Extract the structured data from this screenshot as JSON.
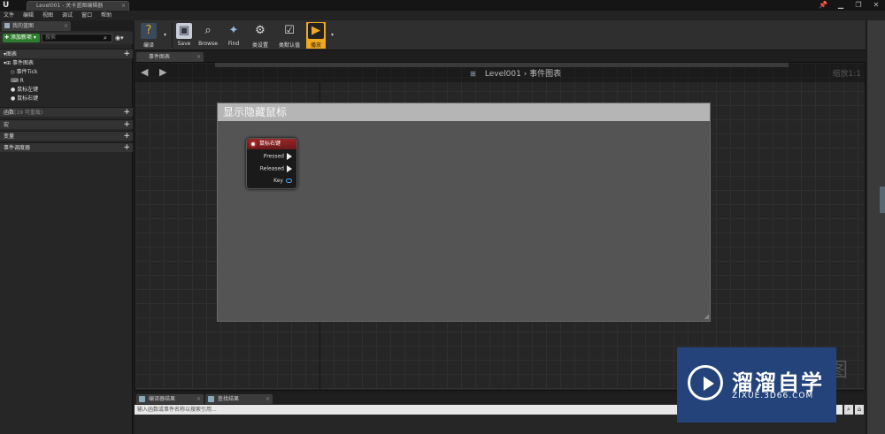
{
  "window": {
    "tab_title": "Level001 - 关卡蓝图编辑器",
    "tab_close": "×",
    "controls": [
      "📌",
      "▁",
      "❐",
      "✕"
    ]
  },
  "menu": [
    "文件",
    "编辑",
    "视图",
    "调试",
    "窗口",
    "帮助"
  ],
  "left_panel": {
    "tab_label": "我的蓝图",
    "add_button": "✚ 添加新项 ▾",
    "search_placeholder": "搜索",
    "sections": {
      "graphs": "▾图表",
      "functions_label": "函数",
      "functions_count": "(19 可重载)",
      "macros": "宏",
      "variables": "变量",
      "dispatchers": "事件调度器"
    },
    "tree": [
      "事件图表",
      "事件Tick",
      "R",
      "鼠标左键",
      "鼠标右键"
    ]
  },
  "toolbar": {
    "buttons": [
      {
        "label": "编译",
        "icon": "compile-icon"
      },
      {
        "label": "Save",
        "icon": "save-icon"
      },
      {
        "label": "Browse",
        "icon": "browse-icon"
      },
      {
        "label": "Find",
        "icon": "find-icon"
      },
      {
        "label": "类设置",
        "icon": "class-settings-icon"
      },
      {
        "label": "类默认值",
        "icon": "class-defaults-icon"
      },
      {
        "label": "播放",
        "icon": "play-icon"
      }
    ]
  },
  "graph": {
    "tab_label": "事件图表",
    "breadcrumb_level": "Level001",
    "breadcrumb_sep": "›",
    "breadcrumb_graph": "事件图表",
    "zoom": "缩放1:1",
    "comment_title": "显示隐藏鼠标",
    "node": {
      "title": "鼠标右键",
      "pins": [
        "Pressed",
        "Released",
        "Key"
      ]
    },
    "watermark_char": "图"
  },
  "bottom": {
    "tabs": [
      "编译器结果",
      "查找结果"
    ],
    "search_placeholder": "输入函数或事件名称以搜索引用..."
  },
  "watermark": {
    "brand": "溜溜自学",
    "url": "ZIXUE.3D66.COM"
  },
  "colors": {
    "node_header": "#9a2525",
    "add_button": "#2e7d2e",
    "play_button": "#f0a81e",
    "watermark_bg": "#23437a"
  }
}
